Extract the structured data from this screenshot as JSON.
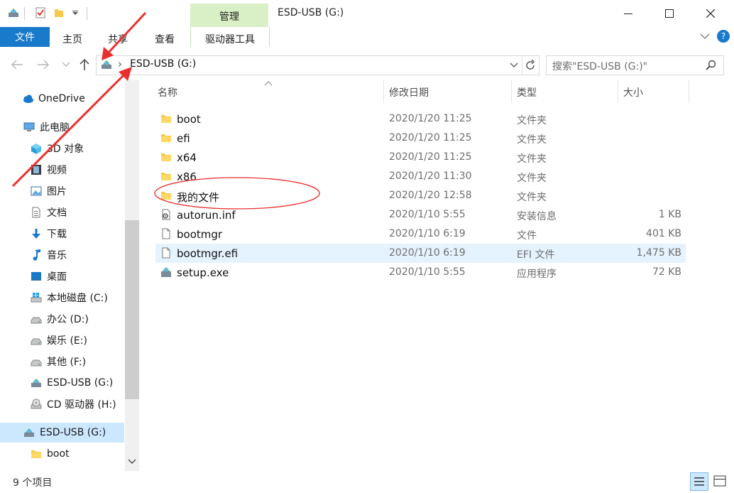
{
  "window": {
    "title": "ESD-USB (G:)",
    "manage_label": "管理",
    "minimize_label": "—",
    "maximize_label": "☐",
    "close_label": "✕"
  },
  "ribbon": {
    "file_tab": "文件",
    "tabs": [
      "主页",
      "共享",
      "查看"
    ],
    "drive_tools": "驱动器工具"
  },
  "address": {
    "path": "ESD-USB (G:)",
    "separator": "›",
    "search_placeholder": "搜索\"ESD-USB (G:)\""
  },
  "sidebar": {
    "items": [
      {
        "label": "OneDrive",
        "icon": "cloud-icon"
      },
      {
        "label": "此电脑",
        "icon": "computer-icon"
      },
      {
        "label": "3D 对象",
        "icon": "cube-icon"
      },
      {
        "label": "视频",
        "icon": "film-icon"
      },
      {
        "label": "图片",
        "icon": "picture-icon"
      },
      {
        "label": "文档",
        "icon": "document-icon"
      },
      {
        "label": "下载",
        "icon": "download-icon"
      },
      {
        "label": "音乐",
        "icon": "music-icon"
      },
      {
        "label": "桌面",
        "icon": "desktop-icon"
      },
      {
        "label": "本地磁盘 (C:)",
        "icon": "windows-drive-icon"
      },
      {
        "label": "办公 (D:)",
        "icon": "drive-icon"
      },
      {
        "label": "娱乐 (E:)",
        "icon": "drive-icon"
      },
      {
        "label": "其他 (F:)",
        "icon": "drive-icon"
      },
      {
        "label": "ESD-USB (G:)",
        "icon": "usb-drive-icon"
      },
      {
        "label": "CD 驱动器 (H:)",
        "icon": "cd-drive-icon"
      },
      {
        "label": "ESD-USB (G:)",
        "icon": "usb-drive-icon"
      },
      {
        "label": "boot",
        "icon": "folder-icon"
      }
    ]
  },
  "columns": {
    "name": "名称",
    "date": "修改日期",
    "type": "类型",
    "size": "大小"
  },
  "files": [
    {
      "name": "boot",
      "date": "2020/1/20 11:25",
      "type": "文件夹",
      "size": "",
      "icon": "folder-icon"
    },
    {
      "name": "efi",
      "date": "2020/1/20 11:25",
      "type": "文件夹",
      "size": "",
      "icon": "folder-icon"
    },
    {
      "name": "x64",
      "date": "2020/1/20 11:25",
      "type": "文件夹",
      "size": "",
      "icon": "folder-icon"
    },
    {
      "name": "x86",
      "date": "2020/1/20 11:30",
      "type": "文件夹",
      "size": "",
      "icon": "folder-icon"
    },
    {
      "name": "我的文件",
      "date": "2020/1/20 12:58",
      "type": "文件夹",
      "size": "",
      "icon": "folder-icon"
    },
    {
      "name": "autorun.inf",
      "date": "2020/1/10 5:55",
      "type": "安装信息",
      "size": "1 KB",
      "icon": "settings-file-icon"
    },
    {
      "name": "bootmgr",
      "date": "2020/1/10 6:19",
      "type": "文件",
      "size": "401 KB",
      "icon": "file-icon"
    },
    {
      "name": "bootmgr.efi",
      "date": "2020/1/10 6:19",
      "type": "EFI 文件",
      "size": "1,475 KB",
      "icon": "file-icon"
    },
    {
      "name": "setup.exe",
      "date": "2020/1/10 5:55",
      "type": "应用程序",
      "size": "72 KB",
      "icon": "setup-icon"
    }
  ],
  "status": {
    "item_count": "9 个项目"
  },
  "colors": {
    "accent": "#1979ca",
    "manage_tab": "#d9f0c6",
    "selection": "#e5f3ff",
    "annotation": "#e8312f"
  }
}
